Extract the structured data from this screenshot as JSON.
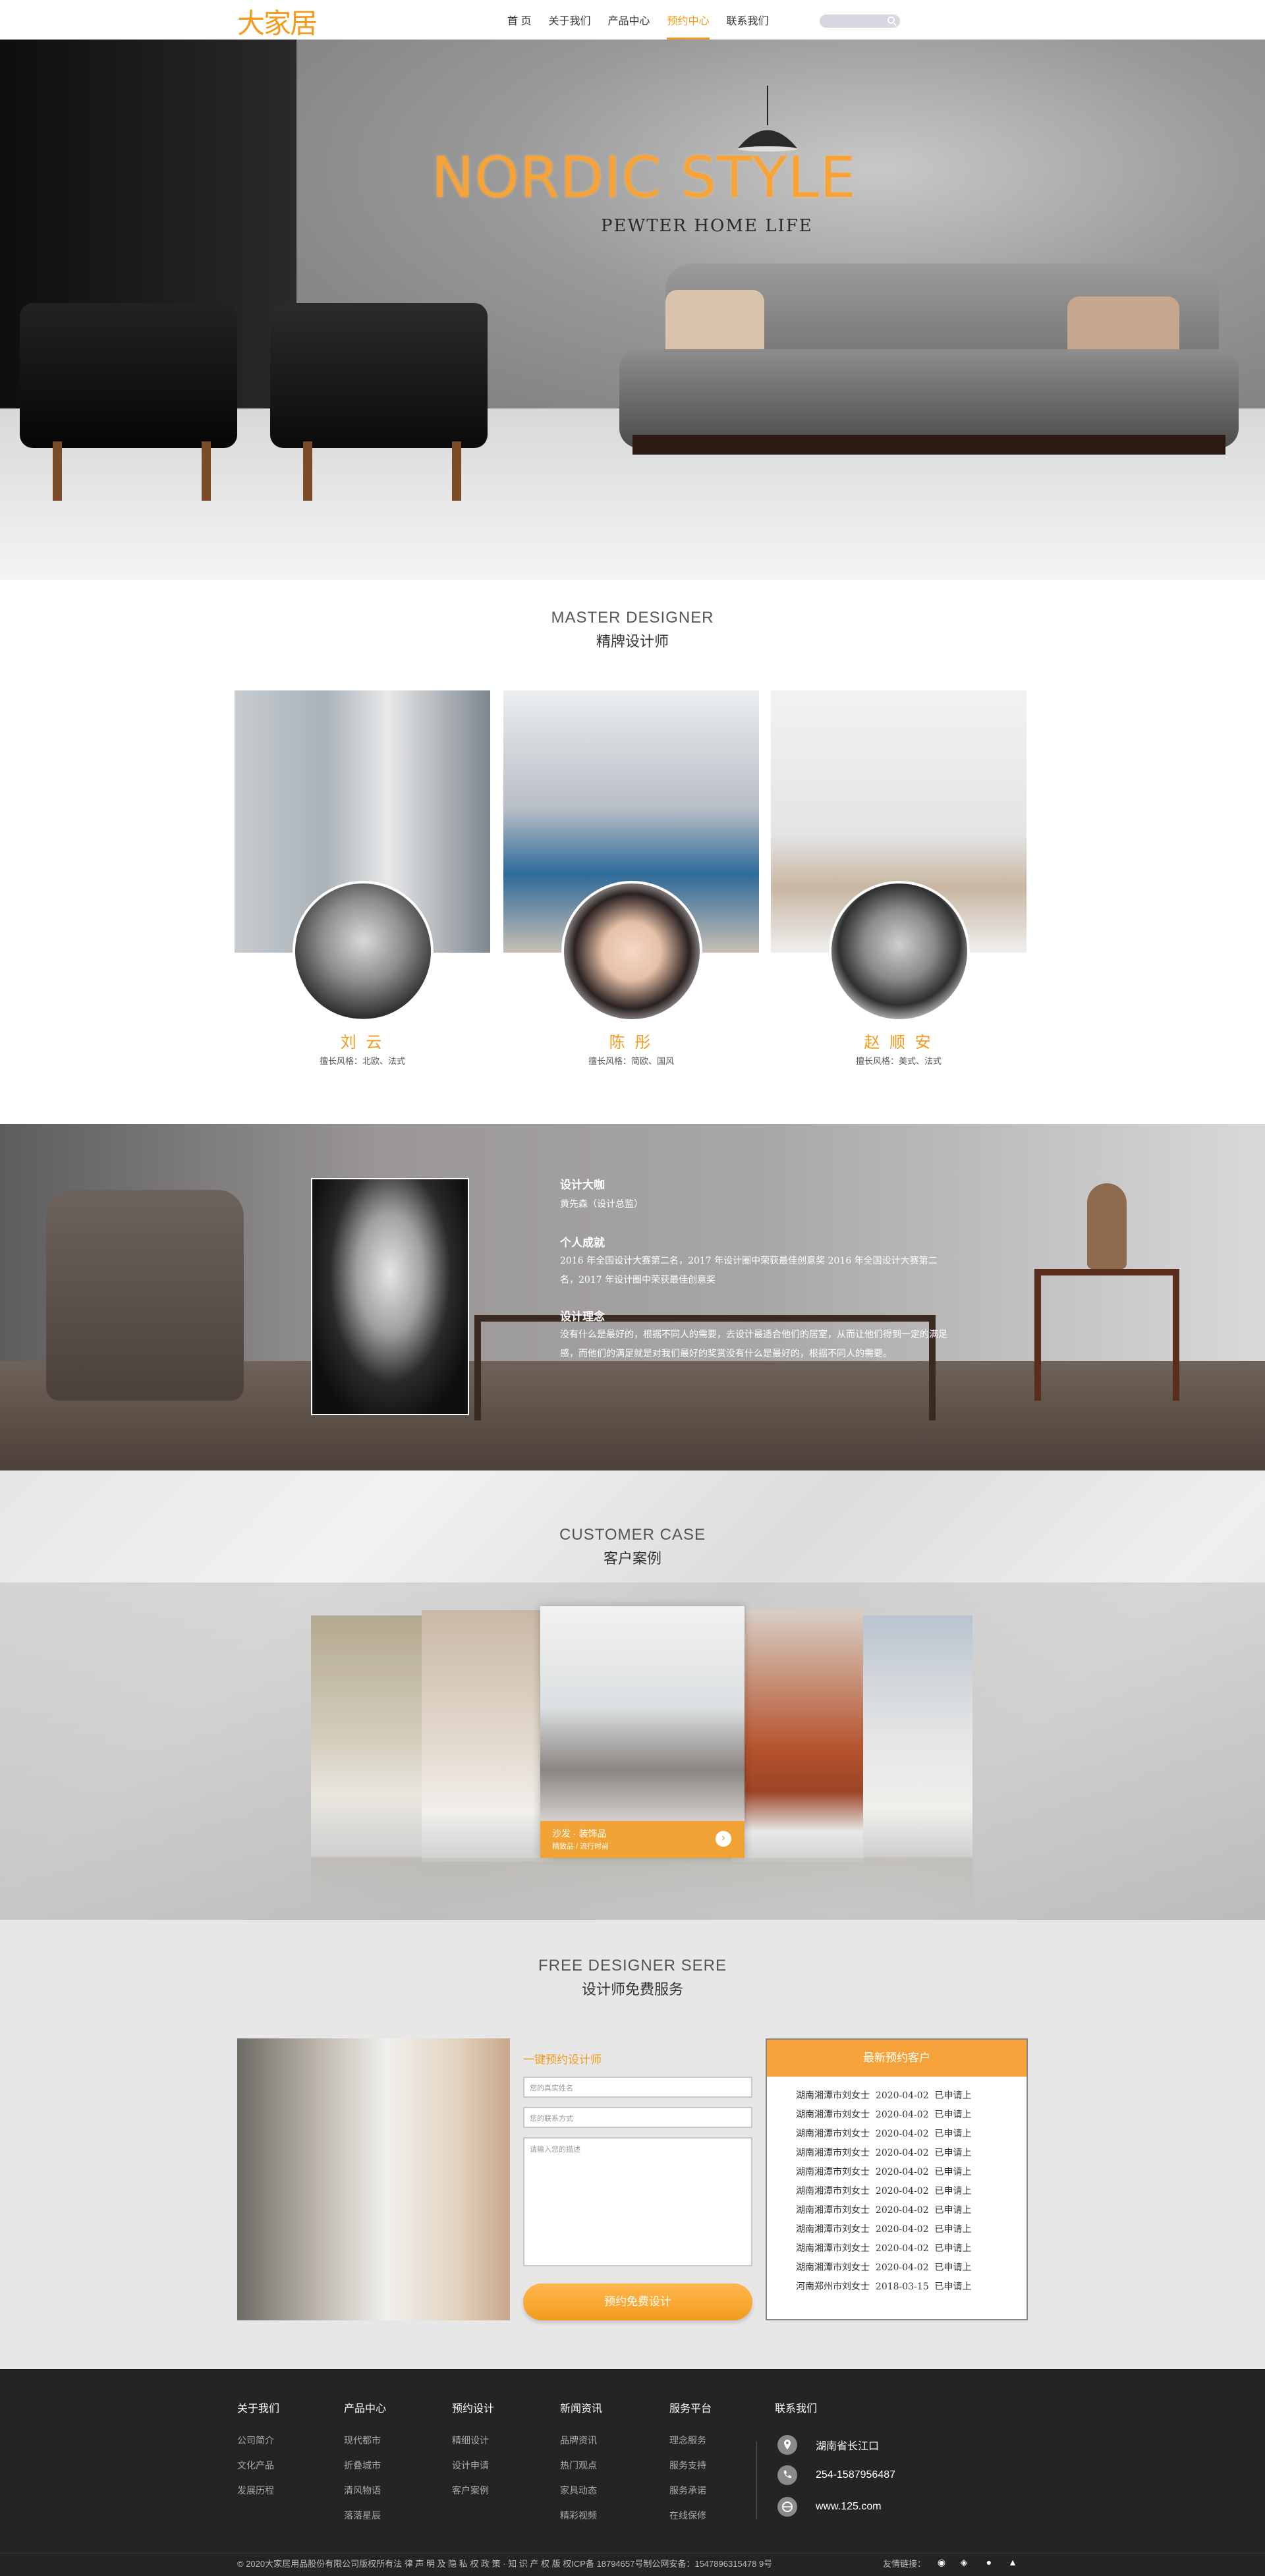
{
  "header": {
    "logo": "大家居",
    "nav": [
      "首 页",
      "关于我们",
      "产品中心",
      "预约中心",
      "联系我们"
    ],
    "active_nav": "预约中心"
  },
  "hero": {
    "title": "NORDIC STYLE",
    "subtitle": "PEWTER HOME LIFE"
  },
  "designers": {
    "title_en": "MASTER DESIGNER",
    "title_cn": "精牌设计师",
    "items": [
      {
        "name": "刘 云",
        "style": "擅长风格：北欧、法式"
      },
      {
        "name": "陈 彤",
        "style": "擅长风格：简欧、国风"
      },
      {
        "name": "赵 顺 安",
        "style": "擅长风格：美式、法式"
      }
    ]
  },
  "featured": {
    "h1": "设计大咖",
    "p1": "黄先森（设计总监）",
    "h2": "个人成就",
    "p2": "2016 年全国设计大赛第二名，2017 年设计圈中荣获最佳创意奖 2016 年全国设计大赛第二名，2017 年设计圈中荣获最佳创意奖",
    "h3": "设计理念",
    "p3": "没有什么是最好的，根据不同人的需要，去设计最适合他们的居室，从而让他们得到一定的满足感，而他们的满足就是对我们最好的奖赏没有什么是最好的，根据不同人的需要。"
  },
  "cases": {
    "title_en": "CUSTOMER CASE",
    "title_cn": "客户案例",
    "caption_title": "沙发 · 装饰品",
    "caption_sub": "精致品 / 流行时尚"
  },
  "free": {
    "title_en": "FREE DESIGNER SERE",
    "title_cn": "设计师免费服务",
    "form_title": "一键预约设计师",
    "name_placeholder": "您的真实姓名",
    "phone_placeholder": "您的联系方式",
    "msg_placeholder": "请输入您的描述",
    "submit": "预约免费设计",
    "list_title": "最新预约客户",
    "list": [
      {
        "who": "湖南湘潭市刘女士",
        "date": "2020-04-02",
        "status": "已申请上"
      },
      {
        "who": "湖南湘潭市刘女士",
        "date": "2020-04-02",
        "status": "已申请上"
      },
      {
        "who": "湖南湘潭市刘女士",
        "date": "2020-04-02",
        "status": "已申请上"
      },
      {
        "who": "湖南湘潭市刘女士",
        "date": "2020-04-02",
        "status": "已申请上"
      },
      {
        "who": "湖南湘潭市刘女士",
        "date": "2020-04-02",
        "status": "已申请上"
      },
      {
        "who": "湖南湘潭市刘女士",
        "date": "2020-04-02",
        "status": "已申请上"
      },
      {
        "who": "湖南湘潭市刘女士",
        "date": "2020-04-02",
        "status": "已申请上"
      },
      {
        "who": "湖南湘潭市刘女士",
        "date": "2020-04-02",
        "status": "已申请上"
      },
      {
        "who": "湖南湘潭市刘女士",
        "date": "2020-04-02",
        "status": "已申请上"
      },
      {
        "who": "湖南湘潭市刘女士",
        "date": "2020-04-02",
        "status": "已申请上"
      },
      {
        "who": "河南郑州市刘女士",
        "date": "2018-03-15",
        "status": "已申请上"
      }
    ]
  },
  "footer": {
    "columns": [
      {
        "title": "关于我们",
        "items": [
          "公司简介",
          "文化产品",
          "发展历程"
        ]
      },
      {
        "title": "产品中心",
        "items": [
          "现代都市",
          "折叠城市",
          "清风物语",
          "落落星辰"
        ]
      },
      {
        "title": "预约设计",
        "items": [
          "精细设计",
          "设计申请",
          "客户案例"
        ]
      },
      {
        "title": "新闻资讯",
        "items": [
          "品牌资讯",
          "热门观点",
          "家具动态",
          "精彩视频"
        ]
      },
      {
        "title": "服务平台",
        "items": [
          "理念服务",
          "服务支持",
          "服务承诺",
          "在线保修"
        ]
      },
      {
        "title": "联系我们",
        "items": []
      }
    ],
    "address": "湖南省长江口",
    "phone": "254-1587956487",
    "website": "www.125.com",
    "copyright": "© 2020大家居用品股份有限公司版权所有法 律 声 明 及 隐 私 权 政 策 · 知 识 产 权 版 权ICP备 18794657号制公网安备：1547896315478 9号",
    "links_label": "友情链接："
  },
  "colors": {
    "accent": "#f29b1d",
    "footer_bg": "#242424"
  }
}
